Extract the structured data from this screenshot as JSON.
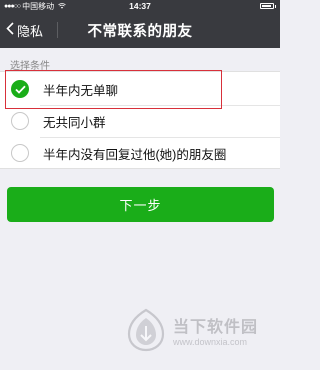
{
  "status_bar": {
    "carrier": "中国移动",
    "time": "14:37"
  },
  "nav": {
    "back_label": "隐私",
    "title": "不常联系的朋友"
  },
  "section": {
    "label": "选择条件"
  },
  "options": [
    {
      "label": "半年内无单聊",
      "checked": true
    },
    {
      "label": "无共同小群",
      "checked": false
    },
    {
      "label": "半年内没有回复过他(她)的朋友圈",
      "checked": false
    }
  ],
  "next_button": {
    "label": "下一步"
  },
  "watermark": {
    "title": "当下软件园",
    "url": "www.downxia.com"
  },
  "colors": {
    "nav_bg": "#393a3f",
    "accent_green": "#1aad19",
    "highlight_red": "#d8303a",
    "page_bg": "#efeff4"
  }
}
